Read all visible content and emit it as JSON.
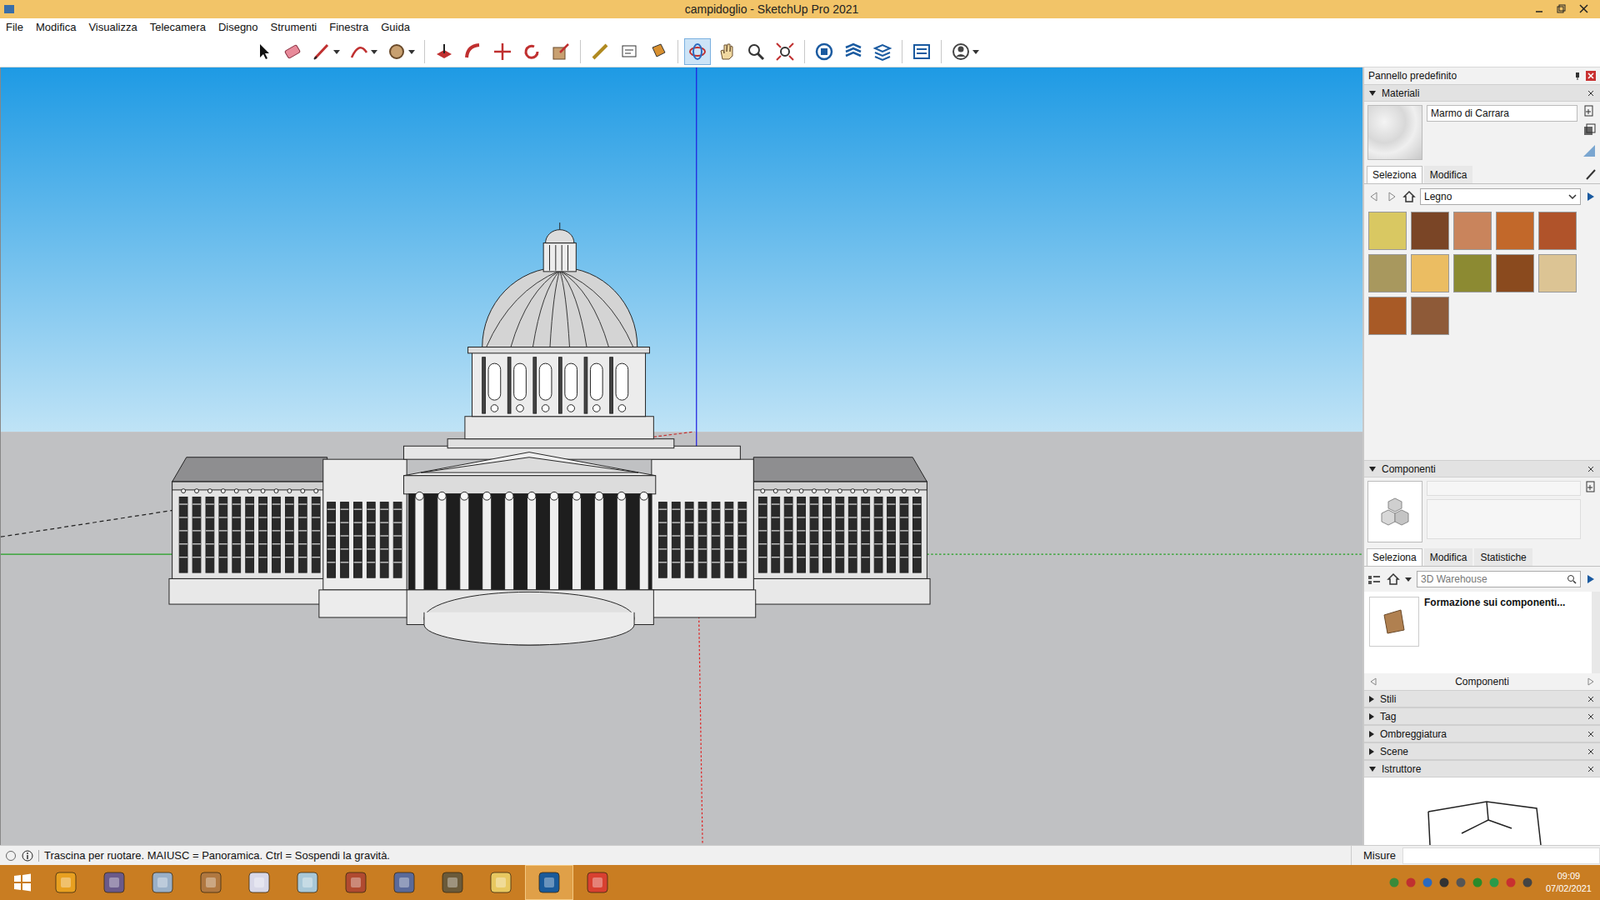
{
  "window": {
    "title": "campidoglio - SketchUp Pro 2021"
  },
  "menu": [
    "File",
    "Modifica",
    "Visualizza",
    "Telecamera",
    "Disegno",
    "Strumenti",
    "Finestra",
    "Guida"
  ],
  "toolbar": [
    {
      "kind": "select",
      "selected": false,
      "dropdown": false
    },
    {
      "kind": "eraser",
      "selected": false,
      "dropdown": false
    },
    {
      "kind": "pencil",
      "selected": false,
      "dropdown": true
    },
    {
      "kind": "arc",
      "selected": false,
      "dropdown": true
    },
    {
      "kind": "shape",
      "selected": false,
      "dropdown": true
    },
    {
      "kind": "separator",
      "selected": false,
      "dropdown": false
    },
    {
      "kind": "pushpull",
      "selected": false,
      "dropdown": false
    },
    {
      "kind": "followme",
      "selected": false,
      "dropdown": false
    },
    {
      "kind": "move",
      "selected": false,
      "dropdown": false
    },
    {
      "kind": "rotate",
      "selected": false,
      "dropdown": false
    },
    {
      "kind": "scale",
      "selected": false,
      "dropdown": false
    },
    {
      "kind": "separator",
      "selected": false,
      "dropdown": false
    },
    {
      "kind": "tape",
      "selected": false,
      "dropdown": false
    },
    {
      "kind": "text",
      "selected": false,
      "dropdown": false
    },
    {
      "kind": "paint",
      "selected": false,
      "dropdown": false
    },
    {
      "kind": "separator",
      "selected": false,
      "dropdown": false
    },
    {
      "kind": "orbit",
      "selected": true,
      "dropdown": false
    },
    {
      "kind": "pan",
      "selected": false,
      "dropdown": false
    },
    {
      "kind": "zoom",
      "selected": false,
      "dropdown": false
    },
    {
      "kind": "zoomext",
      "selected": false,
      "dropdown": false
    },
    {
      "kind": "separator",
      "selected": false,
      "dropdown": false
    },
    {
      "kind": "warehouse",
      "selected": false,
      "dropdown": false
    },
    {
      "kind": "extwarehouse",
      "selected": false,
      "dropdown": false
    },
    {
      "kind": "layout",
      "selected": false,
      "dropdown": false
    },
    {
      "kind": "separator",
      "selected": false,
      "dropdown": false
    },
    {
      "kind": "extensions",
      "selected": false,
      "dropdown": false
    },
    {
      "kind": "separator",
      "selected": false,
      "dropdown": false
    },
    {
      "kind": "account",
      "selected": false,
      "dropdown": true
    }
  ],
  "statusbar": {
    "hint": "Trascina per ruotare. MAIUSC = Panoramica. Ctrl = Sospendi la gravità.",
    "measure_label": "Misure"
  },
  "panel": {
    "title": "Pannello predefinito",
    "materials": {
      "title": "Materiali",
      "expanded": true,
      "name": "Marmo di Carrara",
      "tabs": [
        {
          "label": "Seleziona",
          "selected": true
        },
        {
          "label": "Modifica",
          "selected": false
        }
      ],
      "library": "Legno",
      "swatches": [
        {
          "color": "#d9c862"
        },
        {
          "color": "#7a4526"
        },
        {
          "color": "#c9845c"
        },
        {
          "color": "#c2682a"
        },
        {
          "color": "#b0532a"
        },
        {
          "color": "#a8985e"
        },
        {
          "color": "#ebbd62"
        },
        {
          "color": "#8c8a32"
        },
        {
          "color": "#8a4a1e"
        },
        {
          "color": "#dcc494"
        },
        {
          "color": "#a85a26"
        },
        {
          "color": "#8e5a38"
        }
      ]
    },
    "components": {
      "title": "Componenti",
      "expanded": true,
      "tabs": [
        {
          "label": "Seleziona",
          "selected": true
        },
        {
          "label": "Modifica",
          "selected": false
        },
        {
          "label": "Statistiche",
          "selected": false
        }
      ],
      "search": {
        "placeholder": "3D Warehouse"
      },
      "items": [
        {
          "label": "Formazione sui componenti..."
        }
      ],
      "footer": "Componenti"
    },
    "trays": [
      {
        "title": "Stili",
        "expanded": false
      },
      {
        "title": "Tag",
        "expanded": false
      },
      {
        "title": "Ombreggiatura",
        "expanded": false
      },
      {
        "title": "Scene",
        "expanded": false
      },
      {
        "title": "Istruttore",
        "expanded": true
      }
    ]
  },
  "taskbar": {
    "apps": [
      {
        "kind": "start",
        "active": false,
        "color": "#ffffff"
      },
      {
        "kind": "app",
        "active": false,
        "color": "#e8a020"
      },
      {
        "kind": "app",
        "active": false,
        "color": "#6a5a8a"
      },
      {
        "kind": "app",
        "active": false,
        "color": "#9ab0c8"
      },
      {
        "kind": "app",
        "active": false,
        "color": "#b07840"
      },
      {
        "kind": "app",
        "active": false,
        "color": "#d8d8e8"
      },
      {
        "kind": "app",
        "active": false,
        "color": "#a8c8d8"
      },
      {
        "kind": "app",
        "active": false,
        "color": "#b04a30"
      },
      {
        "kind": "app",
        "active": false,
        "color": "#5a6a9a"
      },
      {
        "kind": "app",
        "active": false,
        "color": "#6a5a3a"
      },
      {
        "kind": "app",
        "active": false,
        "color": "#e8c860"
      },
      {
        "kind": "app",
        "active": true,
        "color": "#1a5a9a"
      },
      {
        "kind": "app",
        "active": false,
        "color": "#d84030"
      }
    ],
    "clock": {
      "time": "09:09",
      "date": "07/02/2021"
    }
  }
}
